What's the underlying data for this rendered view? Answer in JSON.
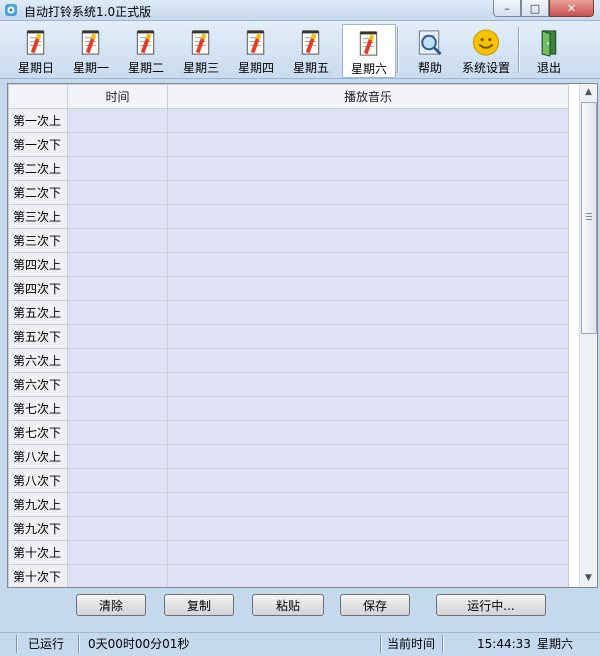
{
  "window": {
    "title": "自动打铃系统1.0正式版",
    "controls": {
      "minimize": "–",
      "maximize": "□",
      "close": "✕"
    }
  },
  "toolbar": {
    "days": [
      {
        "label": "星期日",
        "icon": "schedule-notepad-icon"
      },
      {
        "label": "星期一",
        "icon": "schedule-notepad-icon"
      },
      {
        "label": "星期二",
        "icon": "schedule-notepad-icon"
      },
      {
        "label": "星期三",
        "icon": "schedule-notepad-icon"
      },
      {
        "label": "星期四",
        "icon": "schedule-notepad-icon"
      },
      {
        "label": "星期五",
        "icon": "schedule-notepad-icon"
      },
      {
        "label": "星期六",
        "icon": "schedule-notepad-icon",
        "selected": true
      }
    ],
    "help_label": "帮助",
    "settings_label": "系统设置",
    "exit_label": "退出"
  },
  "grid": {
    "columns": [
      "",
      "时间",
      "播放音乐"
    ],
    "rows": [
      {
        "label": "第一次上",
        "time": "",
        "music": ""
      },
      {
        "label": "第一次下",
        "time": "",
        "music": ""
      },
      {
        "label": "第二次上",
        "time": "",
        "music": ""
      },
      {
        "label": "第二次下",
        "time": "",
        "music": ""
      },
      {
        "label": "第三次上",
        "time": "",
        "music": ""
      },
      {
        "label": "第三次下",
        "time": "",
        "music": ""
      },
      {
        "label": "第四次上",
        "time": "",
        "music": ""
      },
      {
        "label": "第四次下",
        "time": "",
        "music": ""
      },
      {
        "label": "第五次上",
        "time": "",
        "music": ""
      },
      {
        "label": "第五次下",
        "time": "",
        "music": ""
      },
      {
        "label": "第六次上",
        "time": "",
        "music": ""
      },
      {
        "label": "第六次下",
        "time": "",
        "music": ""
      },
      {
        "label": "第七次上",
        "time": "",
        "music": ""
      },
      {
        "label": "第七次下",
        "time": "",
        "music": ""
      },
      {
        "label": "第八次上",
        "time": "",
        "music": ""
      },
      {
        "label": "第八次下",
        "time": "",
        "music": ""
      },
      {
        "label": "第九次上",
        "time": "",
        "music": ""
      },
      {
        "label": "第九次下",
        "time": "",
        "music": ""
      },
      {
        "label": "第十次上",
        "time": "",
        "music": ""
      },
      {
        "label": "第十次下",
        "time": "",
        "music": ""
      }
    ]
  },
  "buttons": {
    "clear": "清除",
    "copy": "复制",
    "paste": "粘贴",
    "save": "保存",
    "run": "运行中..."
  },
  "status": {
    "running_label": "已运行",
    "running_time": "0天00时00分01秒",
    "current_time_label": "当前时间",
    "clock": "15:44:33",
    "weekday": "星期六"
  },
  "colors": {
    "chrome": "#c5d9ee",
    "grid_cell": "#dfe1f4",
    "accent_yellow": "#f5c400"
  }
}
